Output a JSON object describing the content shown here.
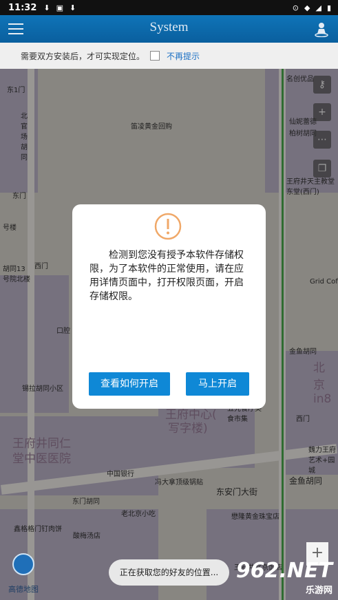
{
  "status": {
    "time": "11:32",
    "icons": [
      "download-icon",
      "alert-icon",
      "download-icon"
    ],
    "right_icons": [
      "location-icon",
      "wifi-icon",
      "signal-icon",
      "battery-icon"
    ]
  },
  "appbar": {
    "title": "System"
  },
  "tipbar": {
    "text": "需要双方安装后，才可实现定位。",
    "no_remind": "不再提示"
  },
  "map": {
    "labels": [
      "东1门",
      "北官场胡同",
      "笛凌黄金回购",
      "名创优品",
      "柏树胡同",
      "仙妮蕾德",
      "王府井天主教堂东堂(西门)",
      "号楼",
      "东门",
      "西门",
      "胡同13号院北楼",
      "口腔",
      "锡拉胡同小区",
      "Grid Coff",
      "金鱼胡同",
      "北京in8",
      "王府井同仁堂中医医院",
      "王府中心写字楼",
      "五先餐厅美食市集",
      "西门",
      "魏力王府艺术+园城",
      "中国银行",
      "冯大拿顶级锅贴",
      "东安门大街",
      "东门胡同",
      "老北京小吃",
      "金鱼胡同",
      "鑫格格门钉肉饼",
      "酸梅汤店",
      "懋隆黄金珠宝店",
      "王府井北京饭店"
    ],
    "big_labels": [
      "王府井同仁",
      "堂中医医院",
      "王府中心(",
      "写字楼)"
    ],
    "controls": [
      "key-icon",
      "plus-icon",
      "dots-icon",
      "layers-icon"
    ],
    "zoom_in": "+"
  },
  "dialog": {
    "message": "检测到您没有授予本软件存储权限，为了本软件的正常使用，请在应用详情页面中，打开权限页面，开启存储权限。",
    "btn_how": "查看如何开启",
    "btn_open": "马上开启"
  },
  "toast": "正在获取您的好友的位置...",
  "watermark": {
    "main": "962.NET",
    "sub": "乐游网"
  },
  "logo": "高德地图"
}
